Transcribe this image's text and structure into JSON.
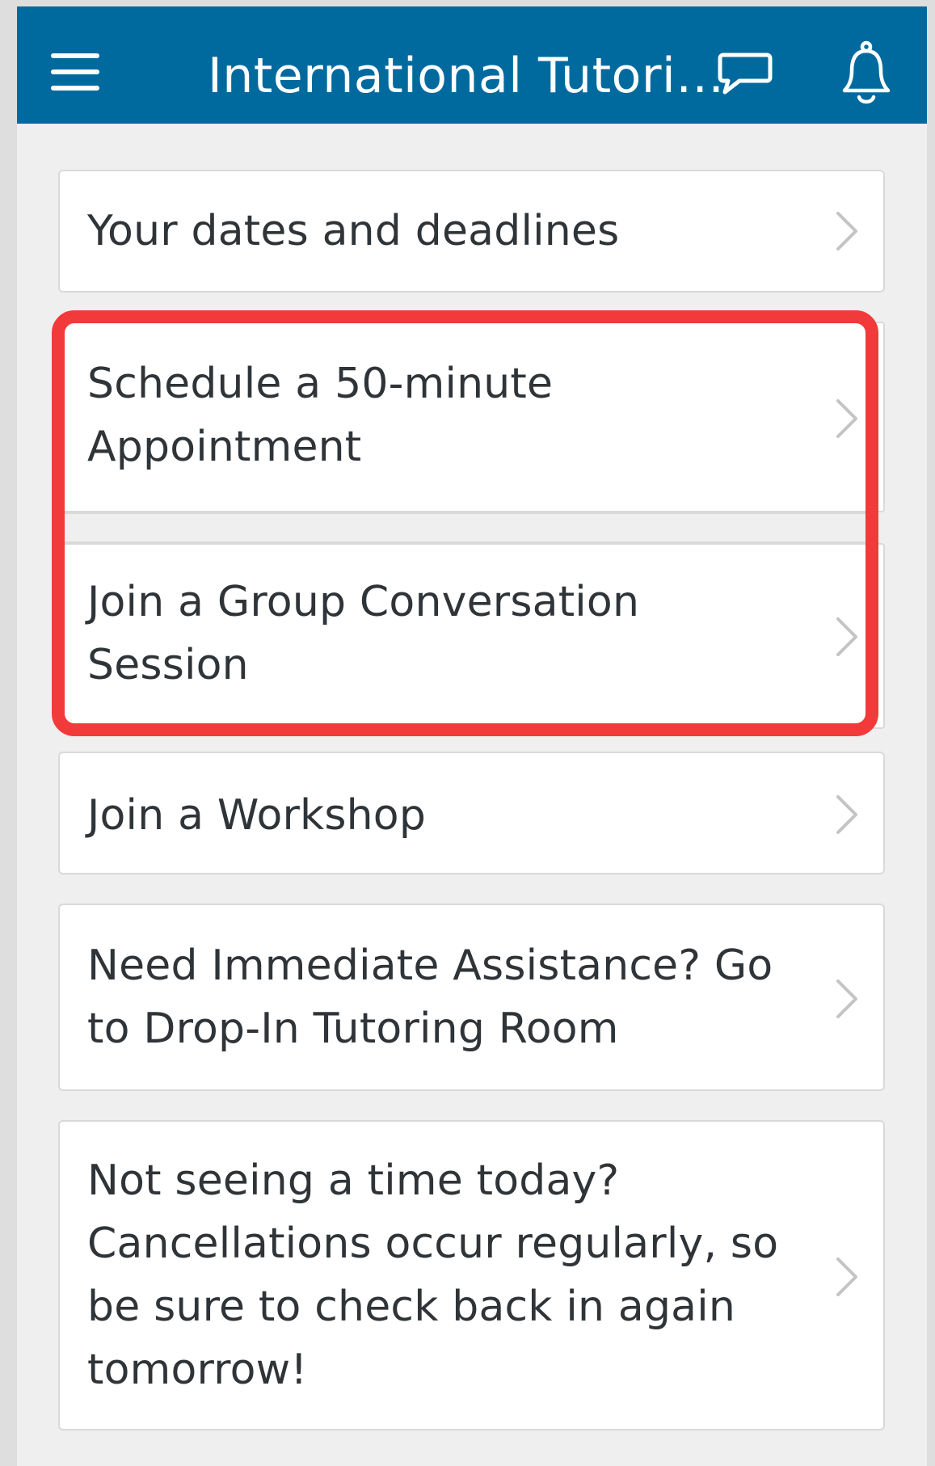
{
  "header": {
    "title": "International Tutori…",
    "menu_icon": "hamburger-icon",
    "chat_icon": "chat-bubble-icon",
    "notifications_icon": "bell-icon",
    "background_color": "#006a9e"
  },
  "menu": {
    "items": [
      {
        "label": "Your dates and deadlines"
      },
      {
        "label": "Schedule a 50-minute Appointment"
      },
      {
        "label": "Join a Group Conversation Session"
      },
      {
        "label": "Join a Workshop"
      },
      {
        "label": "Need Immediate Assistance? Go to Drop-In Tutoring Room"
      },
      {
        "label": "Not seeing a time today? Cancellations occur regularly, so be sure to check back in again tomorrow!"
      }
    ],
    "chevron_icon": "chevron-right-icon"
  },
  "highlight": {
    "color": "#f23a3a"
  }
}
